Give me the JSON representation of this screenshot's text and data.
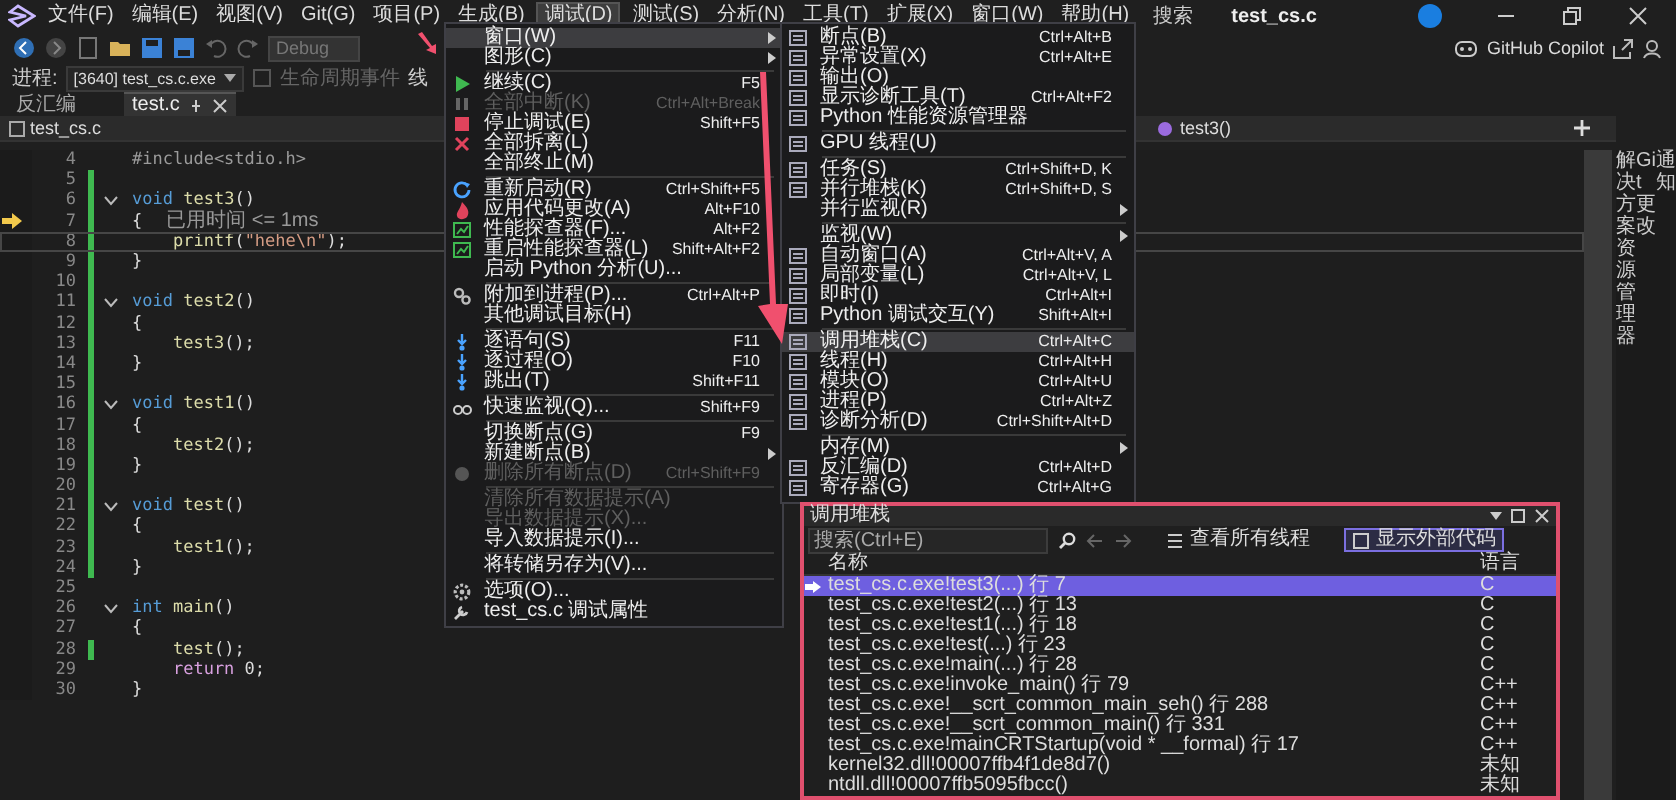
{
  "menu_bar": {
    "items": [
      {
        "label": "文件(F)",
        "selected": false
      },
      {
        "label": "编辑(E)",
        "selected": false
      },
      {
        "label": "视图(V)",
        "selected": false
      },
      {
        "label": "Git(G)",
        "selected": false
      },
      {
        "label": "项目(P)",
        "selected": false
      },
      {
        "label": "生成(B)",
        "selected": false
      },
      {
        "label": "调试(D)",
        "selected": true
      },
      {
        "label": "测试(S)",
        "selected": false
      },
      {
        "label": "分析(N)",
        "selected": false
      },
      {
        "label": "工具(T)",
        "selected": false
      },
      {
        "label": "扩展(X)",
        "selected": false
      },
      {
        "label": "窗口(W)",
        "selected": false
      },
      {
        "label": "帮助(H)",
        "selected": false
      }
    ],
    "search": "搜索",
    "title": "test_cs.c"
  },
  "toolbar": {
    "configuration": "Debug",
    "copilot": "GitHub Copilot"
  },
  "process_bar": {
    "label": "进程:",
    "process": "[3640] test_cs.c.exe",
    "events": "生命周期事件",
    "thread_label": "线"
  },
  "tabs": [
    {
      "label": "反汇编",
      "selected": false
    },
    {
      "label": "test.c",
      "selected": true
    }
  ],
  "nav_bar": {
    "file": "test_cs.c",
    "member": "test3()"
  },
  "code": {
    "lines": [
      {
        "number": "4",
        "tokens": [
          {
            "kind": "pre",
            "text": "#include<stdio.h>"
          }
        ],
        "changed": false,
        "foldable": false,
        "pointer": false,
        "current": false
      },
      {
        "number": "5",
        "changed": true,
        "foldable": false,
        "pointer": false,
        "current": false
      },
      {
        "number": "6",
        "tokens": [
          {
            "kind": "kw",
            "text": "void"
          },
          {
            "kind": "fn",
            "text": " test3"
          },
          {
            "kind": "plain",
            "text": "()"
          }
        ],
        "changed": true,
        "foldable": true,
        "pointer": false,
        "current": false
      },
      {
        "number": "7",
        "tokens": [
          {
            "kind": "plain",
            "text": "{"
          }
        ],
        "hint": "已用时间 <= 1ms",
        "changed": true,
        "foldable": false,
        "pointer": true,
        "current": false
      },
      {
        "number": "8",
        "tokens": [
          {
            "kind": "fn",
            "text": "    printf"
          },
          {
            "kind": "plain",
            "text": "("
          },
          {
            "kind": "str",
            "text": "\"hehe\\n\""
          },
          {
            "kind": "plain",
            "text": ");"
          }
        ],
        "changed": true,
        "foldable": false,
        "pointer": false,
        "current": true
      },
      {
        "number": "9",
        "tokens": [
          {
            "kind": "plain",
            "text": "}"
          }
        ],
        "changed": true,
        "foldable": false,
        "pointer": false,
        "current": false
      },
      {
        "number": "10",
        "changed": true,
        "foldable": false,
        "pointer": false,
        "current": false
      },
      {
        "number": "11",
        "tokens": [
          {
            "kind": "kw",
            "text": "void"
          },
          {
            "kind": "fn",
            "text": " test2"
          },
          {
            "kind": "plain",
            "text": "()"
          }
        ],
        "changed": true,
        "foldable": true,
        "pointer": false,
        "current": false
      },
      {
        "number": "12",
        "tokens": [
          {
            "kind": "plain",
            "text": "{"
          }
        ],
        "changed": true,
        "foldable": false,
        "pointer": false,
        "current": false
      },
      {
        "number": "13",
        "tokens": [
          {
            "kind": "fn",
            "text": "    test3"
          },
          {
            "kind": "plain",
            "text": "();"
          }
        ],
        "changed": true,
        "foldable": false,
        "pointer": false,
        "current": false
      },
      {
        "number": "14",
        "tokens": [
          {
            "kind": "plain",
            "text": "}"
          }
        ],
        "changed": true,
        "foldable": false,
        "pointer": false,
        "current": false
      },
      {
        "number": "15",
        "changed": true,
        "foldable": false,
        "pointer": false,
        "current": false
      },
      {
        "number": "16",
        "tokens": [
          {
            "kind": "kw",
            "text": "void"
          },
          {
            "kind": "fn",
            "text": " test1"
          },
          {
            "kind": "plain",
            "text": "()"
          }
        ],
        "changed": true,
        "foldable": true,
        "pointer": false,
        "current": false
      },
      {
        "number": "17",
        "tokens": [
          {
            "kind": "plain",
            "text": "{"
          }
        ],
        "changed": true,
        "foldable": false,
        "pointer": false,
        "current": false
      },
      {
        "number": "18",
        "tokens": [
          {
            "kind": "fn",
            "text": "    test2"
          },
          {
            "kind": "plain",
            "text": "();"
          }
        ],
        "changed": true,
        "foldable": false,
        "pointer": false,
        "current": false
      },
      {
        "number": "19",
        "tokens": [
          {
            "kind": "plain",
            "text": "}"
          }
        ],
        "changed": true,
        "foldable": false,
        "pointer": false,
        "current": false
      },
      {
        "number": "20",
        "changed": true,
        "foldable": false,
        "pointer": false,
        "current": false
      },
      {
        "number": "21",
        "tokens": [
          {
            "kind": "kw",
            "text": "void"
          },
          {
            "kind": "fn",
            "text": " test"
          },
          {
            "kind": "plain",
            "text": "()"
          }
        ],
        "changed": true,
        "foldable": true,
        "pointer": false,
        "current": false
      },
      {
        "number": "22",
        "tokens": [
          {
            "kind": "plain",
            "text": "{"
          }
        ],
        "changed": true,
        "foldable": false,
        "pointer": false,
        "current": false
      },
      {
        "number": "23",
        "tokens": [
          {
            "kind": "fn",
            "text": "    test1"
          },
          {
            "kind": "plain",
            "text": "();"
          }
        ],
        "changed": true,
        "foldable": false,
        "pointer": false,
        "current": false
      },
      {
        "number": "24",
        "tokens": [
          {
            "kind": "plain",
            "text": "}"
          }
        ],
        "changed": true,
        "foldable": false,
        "pointer": false,
        "current": false
      },
      {
        "number": "25",
        "changed": false,
        "foldable": false,
        "pointer": false,
        "current": false
      },
      {
        "number": "26",
        "tokens": [
          {
            "kind": "kw",
            "text": "int"
          },
          {
            "kind": "fn",
            "text": " main"
          },
          {
            "kind": "plain",
            "text": "()"
          }
        ],
        "changed": false,
        "foldable": true,
        "pointer": false,
        "current": false
      },
      {
        "number": "27",
        "tokens": [
          {
            "kind": "plain",
            "text": "{"
          }
        ],
        "changed": false,
        "foldable": false,
        "pointer": false,
        "current": false
      },
      {
        "number": "28",
        "tokens": [
          {
            "kind": "fn",
            "text": "    test"
          },
          {
            "kind": "plain",
            "text": "();"
          }
        ],
        "changed": true,
        "foldable": false,
        "pointer": false,
        "current": false
      },
      {
        "number": "29",
        "tokens": [
          {
            "kind": "ctrl",
            "text": "    return"
          },
          {
            "kind": "plain",
            "text": " 0;"
          }
        ],
        "changed": false,
        "foldable": false,
        "pointer": false,
        "current": false
      },
      {
        "number": "30",
        "tokens": [
          {
            "kind": "plain",
            "text": "}"
          }
        ],
        "changed": false,
        "foldable": false,
        "pointer": false,
        "current": false
      }
    ]
  },
  "side_tabs": [
    "解决方案资源管理器",
    "Git 更改",
    "通知"
  ],
  "debug_menu": {
    "groups": [
      [
        {
          "label": "窗口(W)",
          "submenu": true,
          "disabled": false,
          "selected": true
        },
        {
          "label": "图形(C)",
          "submenu": true,
          "disabled": false,
          "selected": false
        }
      ],
      [
        {
          "label": "继续(C)",
          "shortcut": "F5",
          "submenu": false,
          "disabled": false,
          "selected": false
        },
        {
          "label": "全部中断(K)",
          "shortcut": "Ctrl+Alt+Break",
          "submenu": false,
          "disabled": true,
          "selected": false
        },
        {
          "label": "停止调试(E)",
          "shortcut": "Shift+F5",
          "submenu": false,
          "disabled": false,
          "selected": false
        },
        {
          "label": "全部拆离(L)",
          "submenu": false,
          "disabled": false,
          "selected": false
        },
        {
          "label": "全部终止(M)",
          "submenu": false,
          "disabled": false,
          "selected": false
        }
      ],
      [
        {
          "label": "重新启动(R)",
          "shortcut": "Ctrl+Shift+F5",
          "submenu": false,
          "disabled": false,
          "selected": false
        },
        {
          "label": "应用代码更改(A)",
          "shortcut": "Alt+F10",
          "submenu": false,
          "disabled": false,
          "selected": false
        },
        {
          "label": "性能探查器(F)...",
          "shortcut": "Alt+F2",
          "submenu": false,
          "disabled": false,
          "selected": false
        },
        {
          "label": "重启性能探查器(L)",
          "shortcut": "Shift+Alt+F2",
          "submenu": false,
          "disabled": false,
          "selected": false
        },
        {
          "label": "启动 Python 分析(U)...",
          "submenu": false,
          "disabled": false,
          "selected": false
        }
      ],
      [
        {
          "label": "附加到进程(P)...",
          "shortcut": "Ctrl+Alt+P",
          "submenu": false,
          "disabled": false,
          "selected": false
        },
        {
          "label": "其他调试目标(H)",
          "submenu": false,
          "disabled": false,
          "selected": false
        }
      ],
      [
        {
          "label": "逐语句(S)",
          "shortcut": "F11",
          "submenu": false,
          "disabled": false,
          "selected": false
        },
        {
          "label": "逐过程(O)",
          "shortcut": "F10",
          "submenu": false,
          "disabled": false,
          "selected": false
        },
        {
          "label": "跳出(T)",
          "shortcut": "Shift+F11",
          "submenu": false,
          "disabled": false,
          "selected": false
        }
      ],
      [
        {
          "label": "快速监视(Q)...",
          "shortcut": "Shift+F9",
          "submenu": false,
          "disabled": false,
          "selected": false
        }
      ],
      [
        {
          "label": "切换断点(G)",
          "shortcut": "F9",
          "submenu": false,
          "disabled": false,
          "selected": false
        },
        {
          "label": "新建断点(B)",
          "submenu": true,
          "disabled": false,
          "selected": false
        },
        {
          "label": "删除所有断点(D)",
          "shortcut": "Ctrl+Shift+F9",
          "submenu": false,
          "disabled": true,
          "selected": false
        }
      ],
      [
        {
          "label": "清除所有数据提示(A)",
          "submenu": false,
          "disabled": true,
          "selected": false
        },
        {
          "label": "导出数据提示(X)...",
          "submenu": false,
          "disabled": true,
          "selected": false
        },
        {
          "label": "导入数据提示(I)...",
          "submenu": false,
          "disabled": false,
          "selected": false
        }
      ],
      [
        {
          "label": "将转储另存为(V)...",
          "submenu": false,
          "disabled": false,
          "selected": false
        }
      ],
      [
        {
          "label": "选项(O)...",
          "submenu": false,
          "disabled": false,
          "selected": false
        },
        {
          "label": "test_cs.c 调试属性",
          "submenu": false,
          "disabled": false,
          "selected": false
        }
      ]
    ]
  },
  "window_menu": {
    "groups": [
      [
        {
          "label": "断点(B)",
          "shortcut": "Ctrl+Alt+B",
          "submenu": false,
          "selected": false
        },
        {
          "label": "异常设置(X)",
          "shortcut": "Ctrl+Alt+E",
          "submenu": false,
          "selected": false
        },
        {
          "label": "输出(O)",
          "submenu": false,
          "selected": false
        },
        {
          "label": "显示诊断工具(T)",
          "shortcut": "Ctrl+Alt+F2",
          "submenu": false,
          "selected": false
        },
        {
          "label": "Python 性能资源管理器",
          "submenu": false,
          "selected": false
        }
      ],
      [
        {
          "label": "GPU 线程(U)",
          "submenu": false,
          "selected": false
        }
      ],
      [
        {
          "label": "任务(S)",
          "shortcut": "Ctrl+Shift+D, K",
          "submenu": false,
          "selected": false
        },
        {
          "label": "并行堆栈(K)",
          "shortcut": "Ctrl+Shift+D, S",
          "submenu": false,
          "selected": false
        },
        {
          "label": "并行监视(R)",
          "submenu": true,
          "selected": false
        }
      ],
      [
        {
          "label": "监视(W)",
          "submenu": true,
          "selected": false
        },
        {
          "label": "自动窗口(A)",
          "shortcut": "Ctrl+Alt+V, A",
          "submenu": false,
          "selected": false
        },
        {
          "label": "局部变量(L)",
          "shortcut": "Ctrl+Alt+V, L",
          "submenu": false,
          "selected": false
        },
        {
          "label": "即时(I)",
          "shortcut": "Ctrl+Alt+I",
          "submenu": false,
          "selected": false
        },
        {
          "label": "Python 调试交互(Y)",
          "shortcut": "Shift+Alt+I",
          "submenu": false,
          "selected": false
        }
      ],
      [
        {
          "label": "调用堆栈(C)",
          "shortcut": "Ctrl+Alt+C",
          "submenu": false,
          "selected": true
        },
        {
          "label": "线程(H)",
          "shortcut": "Ctrl+Alt+H",
          "submenu": false,
          "selected": false
        },
        {
          "label": "模块(O)",
          "shortcut": "Ctrl+Alt+U",
          "submenu": false,
          "selected": false
        },
        {
          "label": "进程(P)",
          "shortcut": "Ctrl+Alt+Z",
          "submenu": false,
          "selected": false
        },
        {
          "label": "诊断分析(D)",
          "shortcut": "Ctrl+Shift+Alt+D",
          "submenu": false,
          "selected": false
        }
      ],
      [
        {
          "label": "内存(M)",
          "submenu": true,
          "selected": false
        },
        {
          "label": "反汇编(D)",
          "shortcut": "Ctrl+Alt+D",
          "submenu": false,
          "selected": false
        },
        {
          "label": "寄存器(G)",
          "shortcut": "Ctrl+Alt+G",
          "submenu": false,
          "selected": false
        }
      ]
    ]
  },
  "call_stack": {
    "title": "调用堆栈",
    "search": {
      "placeholder": "搜索(Ctrl+E)"
    },
    "buttons": [
      {
        "label": "查看所有线程",
        "selected": false
      },
      {
        "label": "显示外部代码",
        "selected": true
      }
    ],
    "columns": [
      "名称",
      "语言"
    ],
    "rows": [
      {
        "name": "test_cs.c.exe!test3(...) 行 7",
        "language": "C",
        "selected": true
      },
      {
        "name": "test_cs.c.exe!test2(...) 行 13",
        "language": "C",
        "selected": false
      },
      {
        "name": "test_cs.c.exe!test1(...) 行 18",
        "language": "C",
        "selected": false
      },
      {
        "name": "test_cs.c.exe!test(...) 行 23",
        "language": "C",
        "selected": false
      },
      {
        "name": "test_cs.c.exe!main(...) 行 28",
        "language": "C",
        "selected": false
      },
      {
        "name": "test_cs.c.exe!invoke_main() 行 79",
        "language": "C++",
        "selected": false
      },
      {
        "name": "test_cs.c.exe!__scrt_common_main_seh() 行 288",
        "language": "C++",
        "selected": false
      },
      {
        "name": "test_cs.c.exe!__scrt_common_main() 行 331",
        "language": "C++",
        "selected": false
      },
      {
        "name": "test_cs.c.exe!mainCRTStartup(void * __formal) 行 17",
        "language": "C++",
        "selected": false
      },
      {
        "name": "kernel32.dll!00007ffb4f1de8d7()",
        "language": "未知",
        "selected": false
      },
      {
        "name": "ntdll.dll!00007ffb5095fbcc()",
        "language": "未知",
        "selected": false
      }
    ]
  }
}
